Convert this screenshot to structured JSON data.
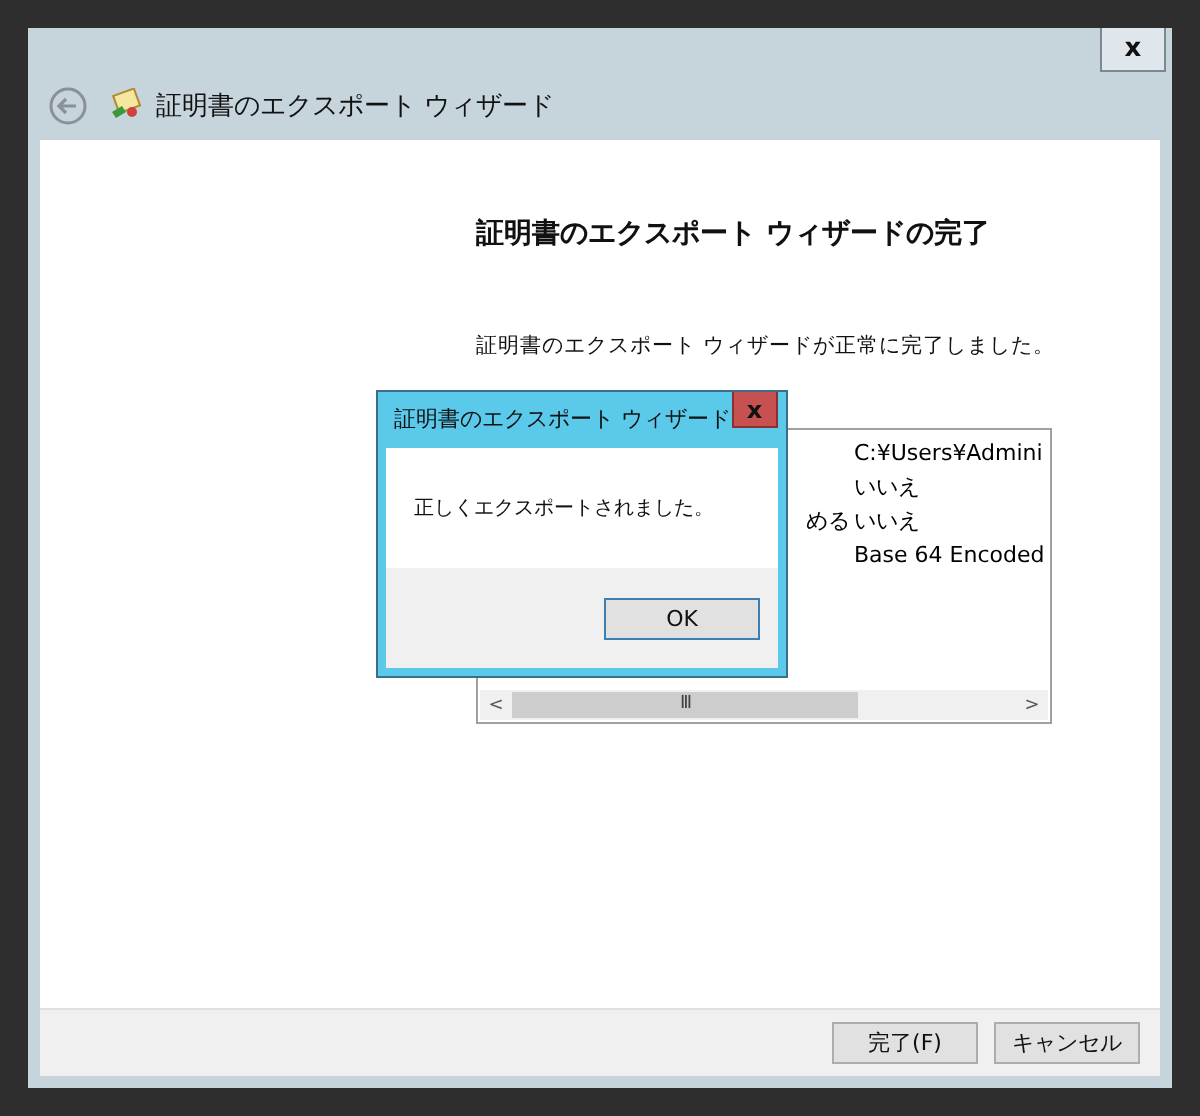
{
  "window": {
    "title": "証明書のエクスポート ウィザード",
    "close": "x"
  },
  "page": {
    "heading": "証明書のエクスポート ウィザードの完了",
    "message": "証明書のエクスポート ウィザードが正常に完了しました。"
  },
  "summary": {
    "rows": [
      {
        "value": "C:¥Users¥Admini"
      },
      {
        "value": "いいえ"
      },
      {
        "label": "める",
        "value": "いいえ"
      },
      {
        "value": "Base 64 Encoded"
      }
    ],
    "scroll_left": "<",
    "scroll_grip": "III",
    "scroll_right": ">"
  },
  "dialog": {
    "title": "証明書のエクスポート ウィザード",
    "close": "x",
    "message": "正しくエクスポートされました。",
    "button": "OK"
  },
  "buttons": [
    {
      "label": "完了(F)"
    },
    {
      "label": "キャンセル"
    }
  ]
}
